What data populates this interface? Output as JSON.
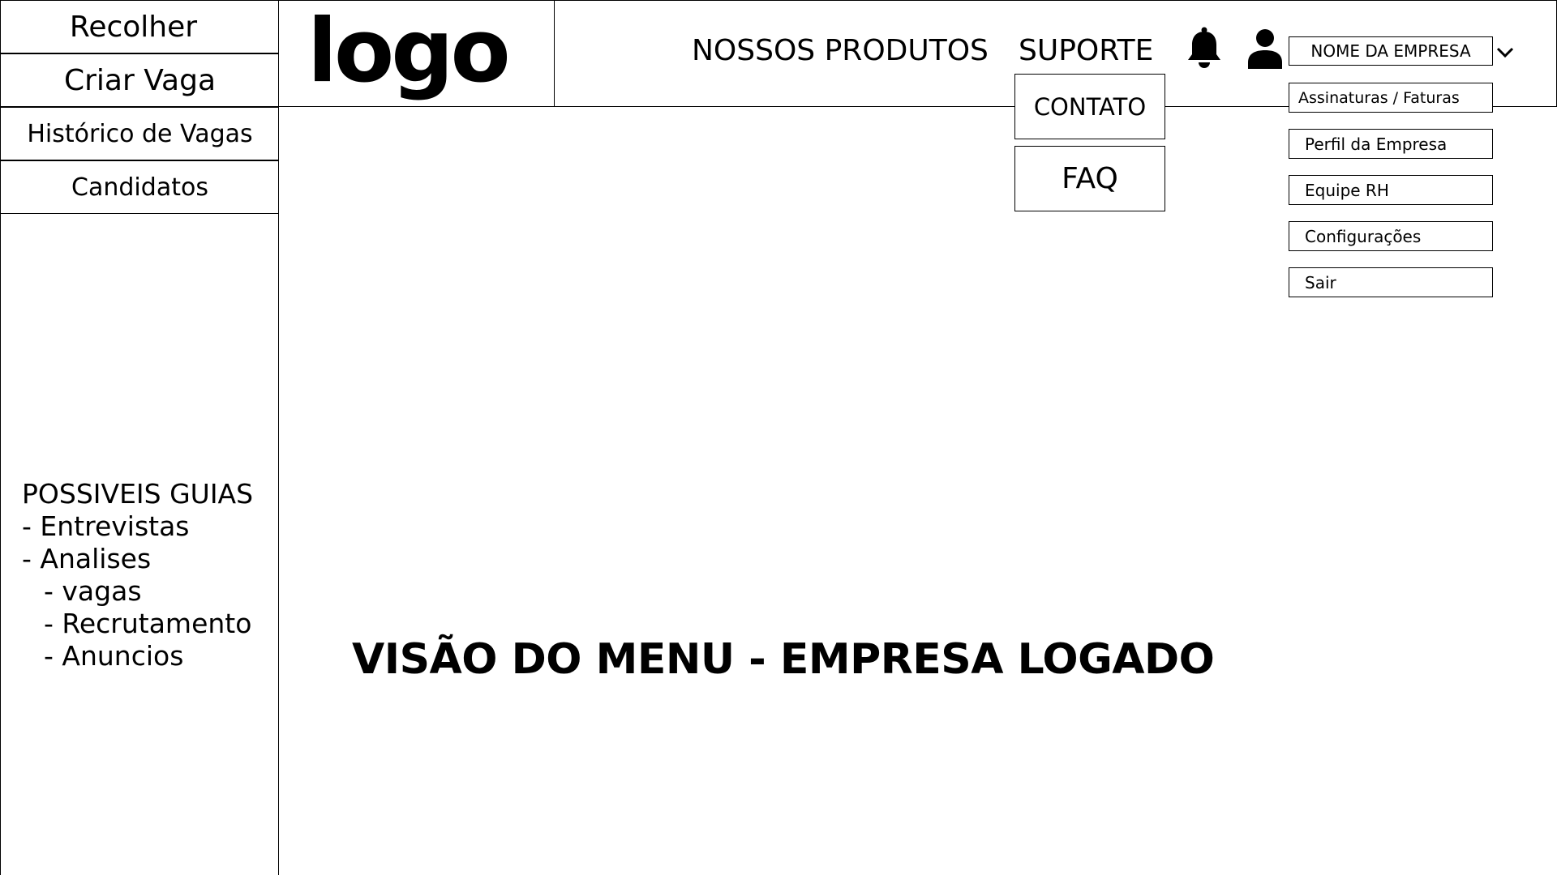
{
  "sidebar": {
    "buttons": [
      {
        "label": "Recolher"
      },
      {
        "label": "Criar Vaga"
      },
      {
        "label": "Histórico de Vagas"
      },
      {
        "label": "Candidatos"
      }
    ],
    "guides": {
      "heading": "POSSIVEIS GUIAS",
      "items": [
        "- Entrevistas",
        "- Analises",
        "- vagas",
        "- Recrutamento",
        "- Anuncios"
      ]
    }
  },
  "header": {
    "logo": "logo",
    "nav": {
      "produtos": "NOSSOS PRODUTOS",
      "suporte": "SUPORTE"
    },
    "icons": {
      "notifications": "bell-icon",
      "user": "user-icon",
      "dropdown": "chevron-down-icon"
    },
    "company_name": "NOME DA EMPRESA"
  },
  "suporte_menu": {
    "items": [
      "CONTATO",
      "FAQ"
    ]
  },
  "company_menu": {
    "items": [
      "Assinaturas / Faturas",
      "Perfil da Empresa",
      "Equipe RH",
      "Configurações",
      "Sair"
    ]
  },
  "main": {
    "title": "VISÃO DO MENU - EMPRESA LOGADO"
  },
  "colors": {
    "foreground": "#000000",
    "background": "#ffffff"
  }
}
